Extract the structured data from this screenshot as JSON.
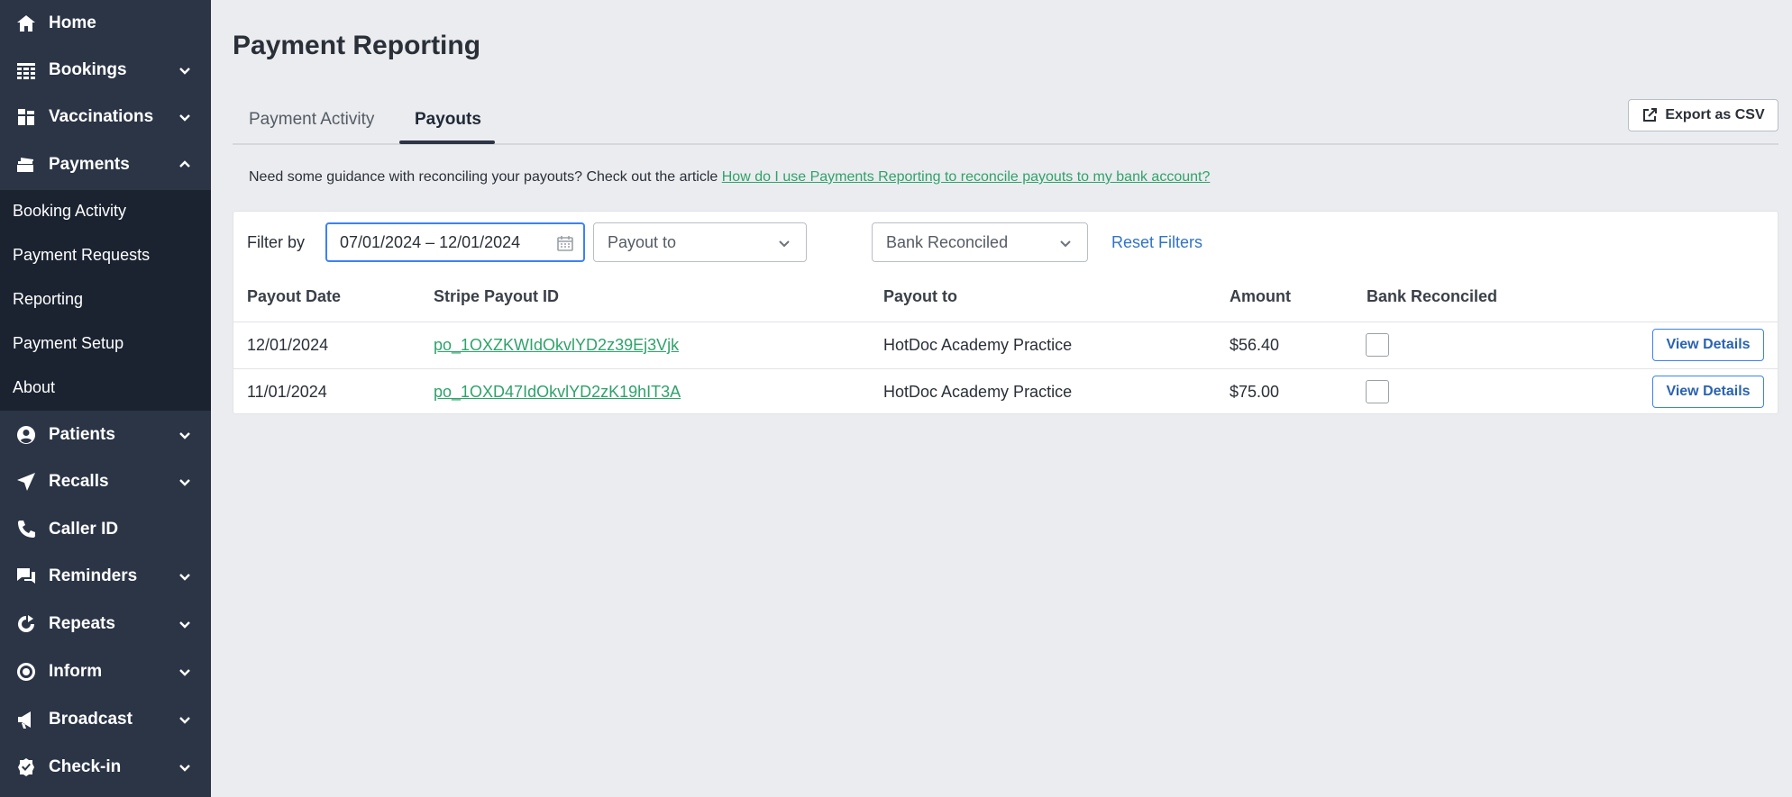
{
  "sidebar": {
    "items": [
      {
        "label": "Home",
        "icon": "home-icon"
      },
      {
        "label": "Bookings",
        "icon": "calendar-grid-icon"
      },
      {
        "label": "Vaccinations",
        "icon": "vaccine-icon"
      },
      {
        "label": "Payments",
        "icon": "card-icon"
      },
      {
        "label": "Patients",
        "icon": "person-icon"
      },
      {
        "label": "Recalls",
        "icon": "paper-plane-icon"
      },
      {
        "label": "Caller ID",
        "icon": "phone-icon"
      },
      {
        "label": "Reminders",
        "icon": "chat-icon"
      },
      {
        "label": "Repeats",
        "icon": "repeat-icon"
      },
      {
        "label": "Inform",
        "icon": "target-icon"
      },
      {
        "label": "Broadcast",
        "icon": "megaphone-icon"
      },
      {
        "label": "Check-in",
        "icon": "check-badge-icon"
      }
    ],
    "payments_subitems": [
      "Booking Activity",
      "Payment Requests",
      "Reporting",
      "Payment Setup",
      "About"
    ]
  },
  "main": {
    "title": "Payment Reporting",
    "tabs": [
      {
        "label": "Payment Activity",
        "active": false
      },
      {
        "label": "Payouts",
        "active": true
      }
    ],
    "export_label": "Export as CSV",
    "guidance_text": "Need some guidance with reconciling your payouts? Check out the article ",
    "guidance_link": "How do I use Payments Reporting to reconcile payouts to my bank account?",
    "filters": {
      "label": "Filter by",
      "date_range": "07/01/2024 – 12/01/2024",
      "payout_to_placeholder": "Payout to",
      "bank_reconciled_placeholder": "Bank Reconciled",
      "reset_label": "Reset Filters"
    },
    "table": {
      "headers": [
        "Payout Date",
        "Stripe Payout ID",
        "Payout to",
        "Amount",
        "Bank Reconciled"
      ],
      "rows": [
        {
          "date": "12/01/2024",
          "payout_id": "po_1OXZKWIdOkvlYD2z39Ej3Vjk",
          "payout_to": "HotDoc Academy Practice",
          "amount": "$56.40",
          "reconciled": false,
          "action": "View Details"
        },
        {
          "date": "11/01/2024",
          "payout_id": "po_1OXD47IdOkvlYD2zK19hIT3A",
          "payout_to": "HotDoc Academy Practice",
          "amount": "$75.00",
          "reconciled": false,
          "action": "View Details"
        }
      ]
    }
  },
  "colors": {
    "sidebar_bg": "#2b3546",
    "subnav_bg": "#1b2331",
    "page_bg": "#ebecef",
    "link_green": "#2ea36a",
    "link_blue": "#3174c5",
    "focus_blue": "#3b82f6"
  }
}
